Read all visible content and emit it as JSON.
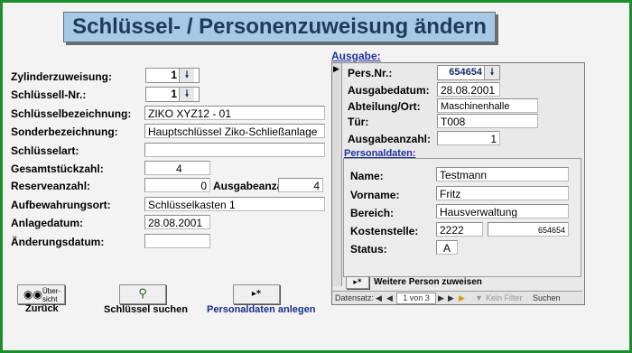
{
  "title": "Schlüssel- / Personenzuweisung ändern",
  "left_form": {
    "zylinder_label": "Zylinderzuweisung:",
    "zylinder_value": "1",
    "schluessel_nr_label": "Schlüssell-Nr.:",
    "schluessel_nr_value": "1",
    "bezeichnung_label": "Schlüsselbezeichnung:",
    "bezeichnung_value": "ZIKO XYZ12 - 01",
    "sonder_label": "Sonderbezeichnung:",
    "sonder_value": "Hauptschlüssel Ziko-Schließanlage",
    "art_label": "Schlüsselart:",
    "art_value": "",
    "gesamt_label": "Gesamtstückzahl:",
    "gesamt_value": "4",
    "reserve_label": "Reserveanzahl:",
    "reserve_value": "0",
    "ausgabeanzahl_label": "Ausgabeanzahl:",
    "ausgabeanzahl_value": "4",
    "aufbewahrung_label": "Aufbewahrungsort:",
    "aufbewahrung_value": "Schlüsselkasten 1",
    "anlage_label": "Anlagedatum:",
    "anlage_value": "28.08.2001",
    "aenderung_label": "Änderungsdatum:",
    "aenderung_value": ""
  },
  "ausgabe": {
    "heading": "Ausgabe:",
    "pers_nr_label": "Pers.Nr.:",
    "pers_nr_value": "654654",
    "ausgabedatum_label": "Ausgabedatum:",
    "ausgabedatum_value": "28.08.2001",
    "abteilung_label": "Abteilung/Ort:",
    "abteilung_value": "Maschinenhalle",
    "tuer_label": "Tür:",
    "tuer_value": "T008",
    "ausgabeanzahl_label": "Ausgabeanzahl:",
    "ausgabeanzahl_value": "1",
    "personaldaten_heading": "Personaldaten:",
    "name_label": "Name:",
    "name_value": "Testmann",
    "vorname_label": "Vorname:",
    "vorname_value": "Fritz",
    "bereich_label": "Bereich:",
    "bereich_value": "Hausverwaltung",
    "kostenstelle_label": "Kostenstelle:",
    "kostenstelle_value": "2222",
    "kostenstelle_value2": "654654",
    "status_label": "Status:",
    "status_value": "A",
    "weitere_button_icon": "▸*",
    "weitere_button_label": "Weitere Person zuweisen",
    "nav_label": "Datensatz:",
    "nav_record": "1 von 3",
    "nav_filter": "Kein Filter",
    "nav_search": "Suchen"
  },
  "buttons": {
    "uebersicht_label_line1": "Über-",
    "uebersicht_label_line2": "sicht",
    "zurueck_caption": "Zurück",
    "suchen_caption": "Schlüssel suchen",
    "personal_caption": "Personaldaten anlegen",
    "new_record_glyph": "▸*"
  },
  "colors": {
    "title_bg": "#a7c9e3",
    "frame_border": "#1a8f2a",
    "link_blue": "#2030a0"
  }
}
